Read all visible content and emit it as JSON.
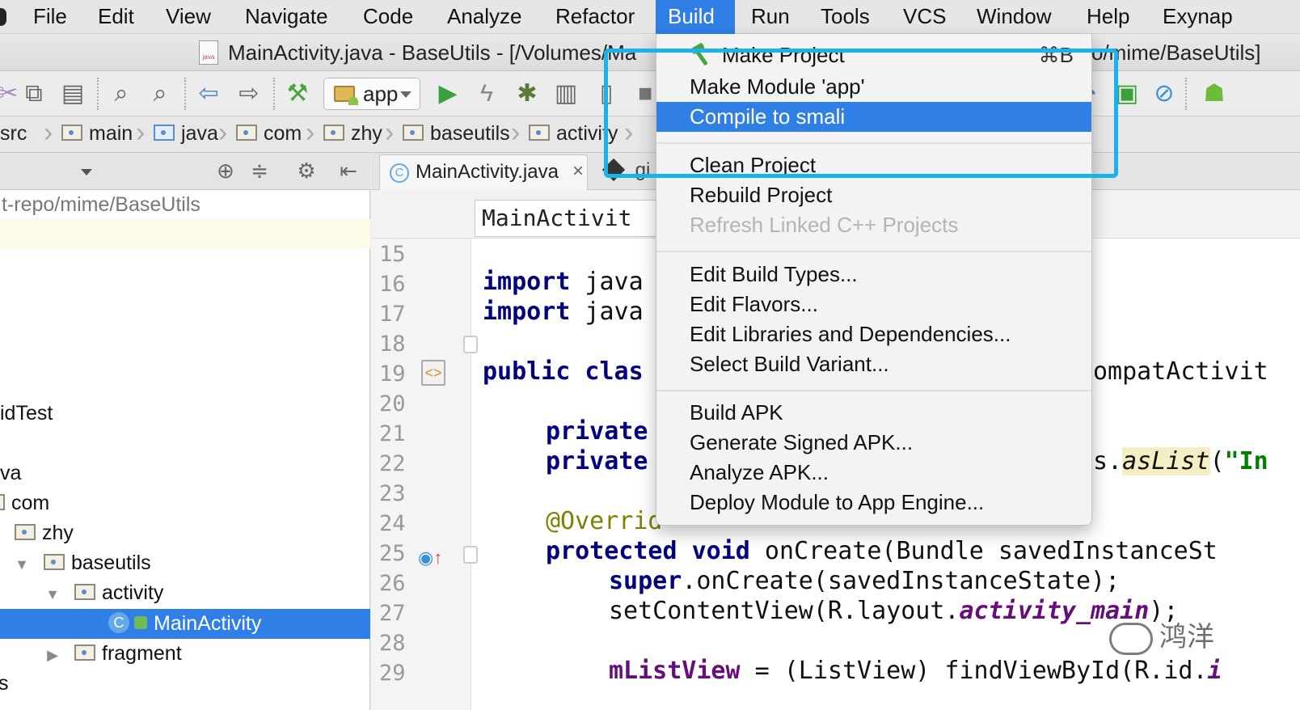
{
  "menubar": {
    "items": [
      "File",
      "Edit",
      "View",
      "Navigate",
      "Code",
      "Analyze",
      "Refactor",
      "Build",
      "Run",
      "Tools",
      "VCS",
      "Window",
      "Help",
      "Exynap"
    ],
    "active": "Build"
  },
  "titlebar": {
    "file_icon_label": "java",
    "title": "MainActivity.java - BaseUtils - [/Volumes/Ma",
    "title_right": "o/mime/BaseUtils]"
  },
  "toolbar": {
    "run_config": "app",
    "icons": [
      "copy-icon",
      "paste-icon",
      "find-icon",
      "replace-icon",
      "back-icon",
      "forward-icon",
      "make-hammer-icon",
      "run-icon",
      "apply-changes-icon",
      "debug-icon",
      "profile-icon",
      "attach-debugger-icon",
      "stop-icon",
      "layout-inspector-icon",
      "block-icon",
      "android-icon"
    ]
  },
  "breadcrumb": [
    "src",
    "main",
    "java",
    "com",
    "zhy",
    "baseutils",
    "activity"
  ],
  "project_panel": {
    "path": "t-repo/mime/BaseUtils",
    "tree": [
      {
        "label": "idTest"
      },
      {
        "label": "va"
      },
      {
        "label": "com"
      },
      {
        "label": "zhy"
      },
      {
        "label": "baseutils"
      },
      {
        "label": "activity"
      },
      {
        "label": "MainActivity",
        "selected": true
      },
      {
        "label": "fragment"
      },
      {
        "label": "s"
      }
    ]
  },
  "editor": {
    "tabs": [
      {
        "label": "MainActivity.java",
        "close": "×"
      },
      {
        "label": ".gi"
      }
    ],
    "nav_field": "MainActivit",
    "line_numbers": [
      "15",
      "16",
      "17",
      "18",
      "19",
      "20",
      "21",
      "22",
      "23",
      "24",
      "25",
      "26",
      "27",
      "28",
      "29"
    ],
    "code": {
      "l16": [
        "import",
        " java"
      ],
      "l17": [
        "import",
        " java"
      ],
      "l19": [
        "public",
        " clas"
      ],
      "l19_right": "ompatActivit",
      "l21": "private",
      "l22": "private",
      "l22_right": [
        "s.",
        "asList",
        "(",
        "\"In"
      ],
      "l24": "@Overrid",
      "l25": [
        "protected",
        " ",
        "void",
        " onCreate(Bundle savedInstanceSt"
      ],
      "l26": [
        "super",
        ".onCreate(savedInstanceState);"
      ],
      "l27": [
        "setContentView(R.layout.",
        "activity_main",
        ");"
      ],
      "l29": [
        "mListView",
        " = (ListView) findViewById(R.id.",
        "i"
      ]
    }
  },
  "build_menu": {
    "items": [
      {
        "label": "Make Project",
        "shortcut": "⌘B"
      },
      {
        "label": "Make Module 'app'"
      },
      {
        "label": "Compile to smali",
        "highlighted": true
      },
      {
        "label": "Clean Project"
      },
      {
        "label": "Rebuild Project"
      },
      {
        "label": "Refresh Linked C++ Projects",
        "disabled": true
      },
      {
        "label": "Edit Build Types..."
      },
      {
        "label": "Edit Flavors..."
      },
      {
        "label": "Edit Libraries and Dependencies..."
      },
      {
        "label": "Select Build Variant..."
      },
      {
        "label": "Build APK"
      },
      {
        "label": "Generate Signed APK..."
      },
      {
        "label": "Analyze APK..."
      },
      {
        "label": "Deploy Module to App Engine..."
      }
    ]
  },
  "watermark": "鸿洋",
  "colors": {
    "accent": "#2f7fe6",
    "callout": "#1ab2ea",
    "keyword": "#000080",
    "field": "#660e7a",
    "annotation": "#808000",
    "string": "#008000"
  }
}
